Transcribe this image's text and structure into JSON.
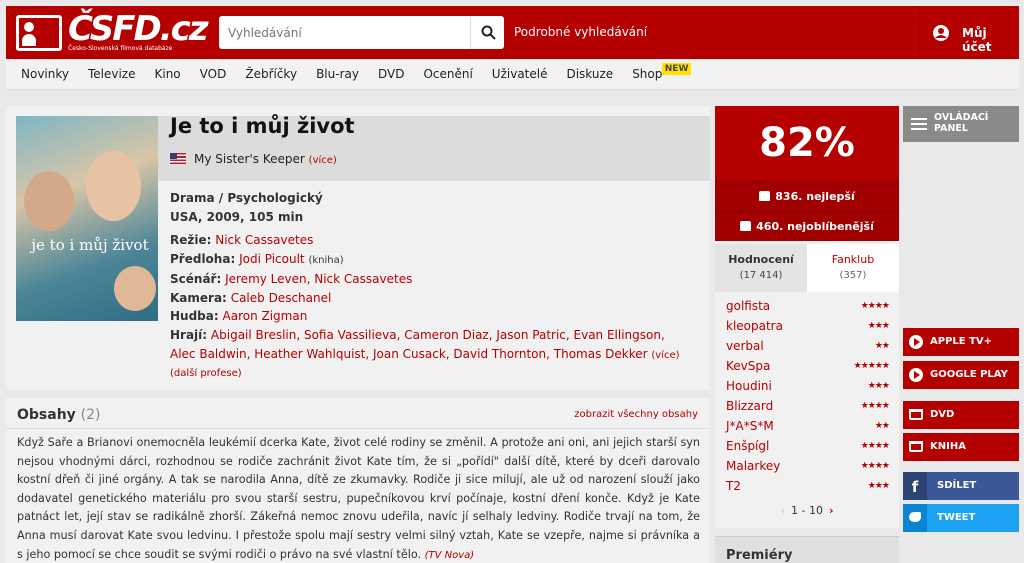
{
  "header": {
    "logo_text": "ČSFD.cz",
    "logo_subtitle": "Česko-Slovenská filmová databáze",
    "search_placeholder": "Vyhledávání",
    "advanced_search": "Podrobné vyhledávání",
    "account": "Můj účet"
  },
  "nav": {
    "items": [
      "Novinky",
      "Televize",
      "Kino",
      "VOD",
      "Žebříčky",
      "Blu-ray",
      "DVD",
      "Ocenění",
      "Uživatelé",
      "Diskuze",
      "Shop"
    ],
    "new_badge": "NEW"
  },
  "film": {
    "poster_title": "je to i můj život",
    "title": "Je to i můj život",
    "original_title": "My Sister's Keeper",
    "original_more": "(více)",
    "genre": "Drama / Psychologický",
    "origin": "USA, 2009, 105 min",
    "directing_label": "Režie:",
    "directing": "Nick Cassavetes",
    "source_label": "Předloha:",
    "source": "Jodi Picoult",
    "source_note": "(kniha)",
    "screenplay_label": "Scénář:",
    "screenplay": "Jeremy Leven, Nick Cassavetes",
    "camera_label": "Kamera:",
    "camera": "Caleb Deschanel",
    "music_label": "Hudba:",
    "music": "Aaron Zigman",
    "cast_label": "Hrají:",
    "cast": "Abigail Breslin, Sofia Vassilieva, Cameron Diaz, Jason Patric, Evan Ellingson, Alec Baldwin, Heather Wahlquist, Joan Cusack, David Thornton, Thomas Dekker",
    "cast_more": "(více)",
    "more_professions": "(další profese)"
  },
  "plot": {
    "heading": "Obsahy",
    "count": "(2)",
    "show_all": "zobrazit všechny obsahy",
    "text": "Když Saře a Brianovi onemocněla leukémií dcerka Kate, život celé rodiny se změnil. A protože ani oni, ani jejich starší syn nejsou vhodnými dárci, rozhodnou se rodiče zachránit život Kate tím, že si „pořídí\" další dítě, které by dceři darovalo kostní dřeň či jiné orgány. A tak se narodila Anna, dítě ze zkumavky. Rodiče ji sice milují, ale už od narození slouží jako dodavatel genetického materiálu pro svou starší sestru, pupečníkovou krví počínaje, kostní dření konče. Když je Kate patnáct let, její stav se radikálně zhorší. Zákeřná nemoc znovu udeřila, navíc jí selhaly ledviny. Rodiče trvají na tom, že Anna musí darovat Kate svou ledvinu. I přestože spolu mají sestry velmi silný vztah, Kate se vzepře, najme si právníka a s jeho pomocí se chce soudit se svými rodiči o právo na své vlastní tělo.",
    "source": "(TV Nova)"
  },
  "rating": {
    "score": "82%",
    "best_rank": "836. nejlepší",
    "popular_rank": "460. nejoblíbenější",
    "tab_ratings": "Hodnocení",
    "tab_ratings_count": "(17 414)",
    "tab_fanclub": "Fanklub",
    "tab_fanclub_count": "(357)",
    "users": [
      {
        "name": "golfista",
        "stars": "★★★★"
      },
      {
        "name": "kleopatra",
        "stars": "★★★"
      },
      {
        "name": "verbal",
        "stars": "★★"
      },
      {
        "name": "KevSpa",
        "stars": "★★★★★"
      },
      {
        "name": "Houdini",
        "stars": "★★★"
      },
      {
        "name": "Blizzard",
        "stars": "★★★★"
      },
      {
        "name": "J*A*S*M",
        "stars": "★★"
      },
      {
        "name": "Enšpígl",
        "stars": "★★★★"
      },
      {
        "name": "Malarkey",
        "stars": "★★★★"
      },
      {
        "name": "T2",
        "stars": "★★★"
      }
    ],
    "pager": "1 - 10",
    "premieres": "Premiéry"
  },
  "side": {
    "panel": "OVLÁDACÍ PANEL",
    "apple": "APPLE TV+",
    "google": "GOOGLE PLAY",
    "dvd": "DVD",
    "book": "KNIHA",
    "share": "SDÍLET",
    "tweet": "TWEET"
  },
  "colors": {
    "brand": "#b50000",
    "facebook": "#3b5998",
    "twitter": "#1da1f2",
    "new_badge": "#ffe000"
  }
}
